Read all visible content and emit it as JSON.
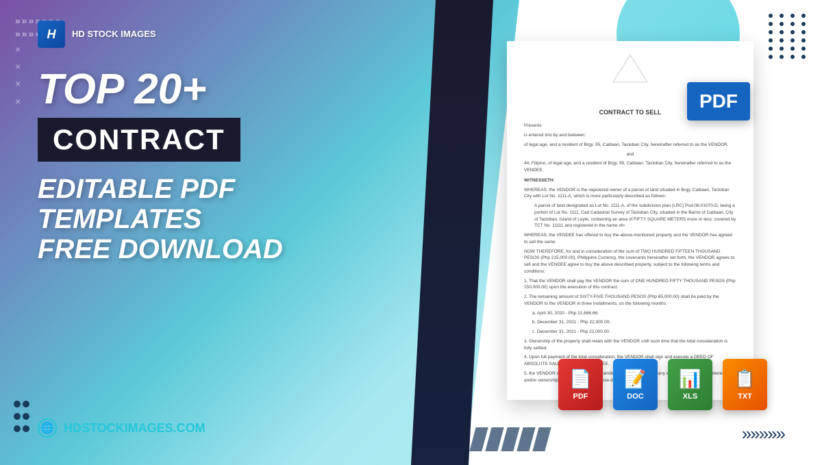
{
  "brand": {
    "logo_letter": "H",
    "name_line1": "HD STOCK IMAGES",
    "website": "HDSTOCKIMAGES.COM"
  },
  "hero": {
    "top_title": "TOP 20+",
    "contract_label": "CONTRACT",
    "subtitle_line1": "EDITABLE PDF TEMPLATES",
    "subtitle_line2": "FREE DOWNLOAD"
  },
  "document": {
    "title": "CONTRACT TO SELL",
    "presents": "Presents",
    "para1": "is entered into by and between:",
    "para2": "of legal age, and a resident of Brgy. 95, Caibaan, Tacloban City, hereinafter referred to as the VENDOR.",
    "and_text": "and",
    "para3": "44, Filipino, of legal age, and a resident of Brgy. 95, Caibaan, Tacloban City, hereinafter referred to as the VENDEE.",
    "witnesseth": "WITNESSETH:",
    "whereas1": "WHEREAS, the VENDOR is the registered owner of a parcel of land situated in Brgy. Caibaan, Tacloban City with Lot No. 1111-A, which is more particularly described as follows:",
    "whereas2": "A parcel of land designated as Lot No. 1111-A, of the subdivision plan (LRC) Psd-08-01070-D, being a portion of Lot No. 1111, Cad Cadastral Survey of Tacloban City, situated in the Barrio of Caibaan, City of Tacloban, Island of Leyte, containing an area of FIFTY SQUARE METERS more or less; covered by TCT No. 11111 and registered in the name of=",
    "whereas3": "WHEREAS, the VENDEE has offered to buy the above-mentioned property and the VENDOR has agreed to sell the same.",
    "now_therefore": "NOW THEREFORE, for and in consideration of the sum of TWO HUNDRED FIFTEEN THOUSAND PESOS (Php 215,000.00), Philippine Currency, the covenants hereinafter set forth, the VENDOR agrees to sell and the VENDEE agree to buy the above described property, subject to the following terms and conditions:",
    "item1": "1. That the VENDOR shall pay the VENDOR the sum of ONE HUNDRED FIFTY THOUSAND PESOS (Php 150,000.00) upon the execution of this contract.",
    "item2": "2. The remaining amount of SIXTY-FIVE THOUSAND PESOS (Php 65,000.00) shall be paid by the VENDOR to the VENDOR in three installments, on the following months:",
    "item2a": "a. April 30, 2020 - Php 21,666.66;",
    "item2b": "b. December 31, 2021 - Php 22,000.00;",
    "item2c": "c. December 31, 2021 - Php 22,000.00.",
    "item3": "3. Ownership of the property shall retain with the VENDOR until such time that the total consideration is fully settled.",
    "item4": "4. Upon full payment of the total consideration, the VENDOR shall sign and execute a DEED OF ABSOLUTE SALE in favor of the VENDEE.",
    "item5": "5. the VENDOR shall not sell alienate, transfer, assign, donate or in any way convey his rights, interest, and/or ownership with respect to the above-described"
  },
  "pdf_badge": "PDF",
  "formats": [
    {
      "label": "PDF",
      "icon": "📄",
      "color": "pdf"
    },
    {
      "label": "DOC",
      "icon": "📝",
      "color": "doc"
    },
    {
      "label": "XLS",
      "icon": "📊",
      "color": "xls"
    },
    {
      "label": "TXT",
      "icon": "📋",
      "color": "txt"
    }
  ],
  "decorations": {
    "chevrons": "»»»»»",
    "bottom_arrows": "»»»»»",
    "x_mark": "×",
    "dots_color": "#1a3a5c"
  }
}
